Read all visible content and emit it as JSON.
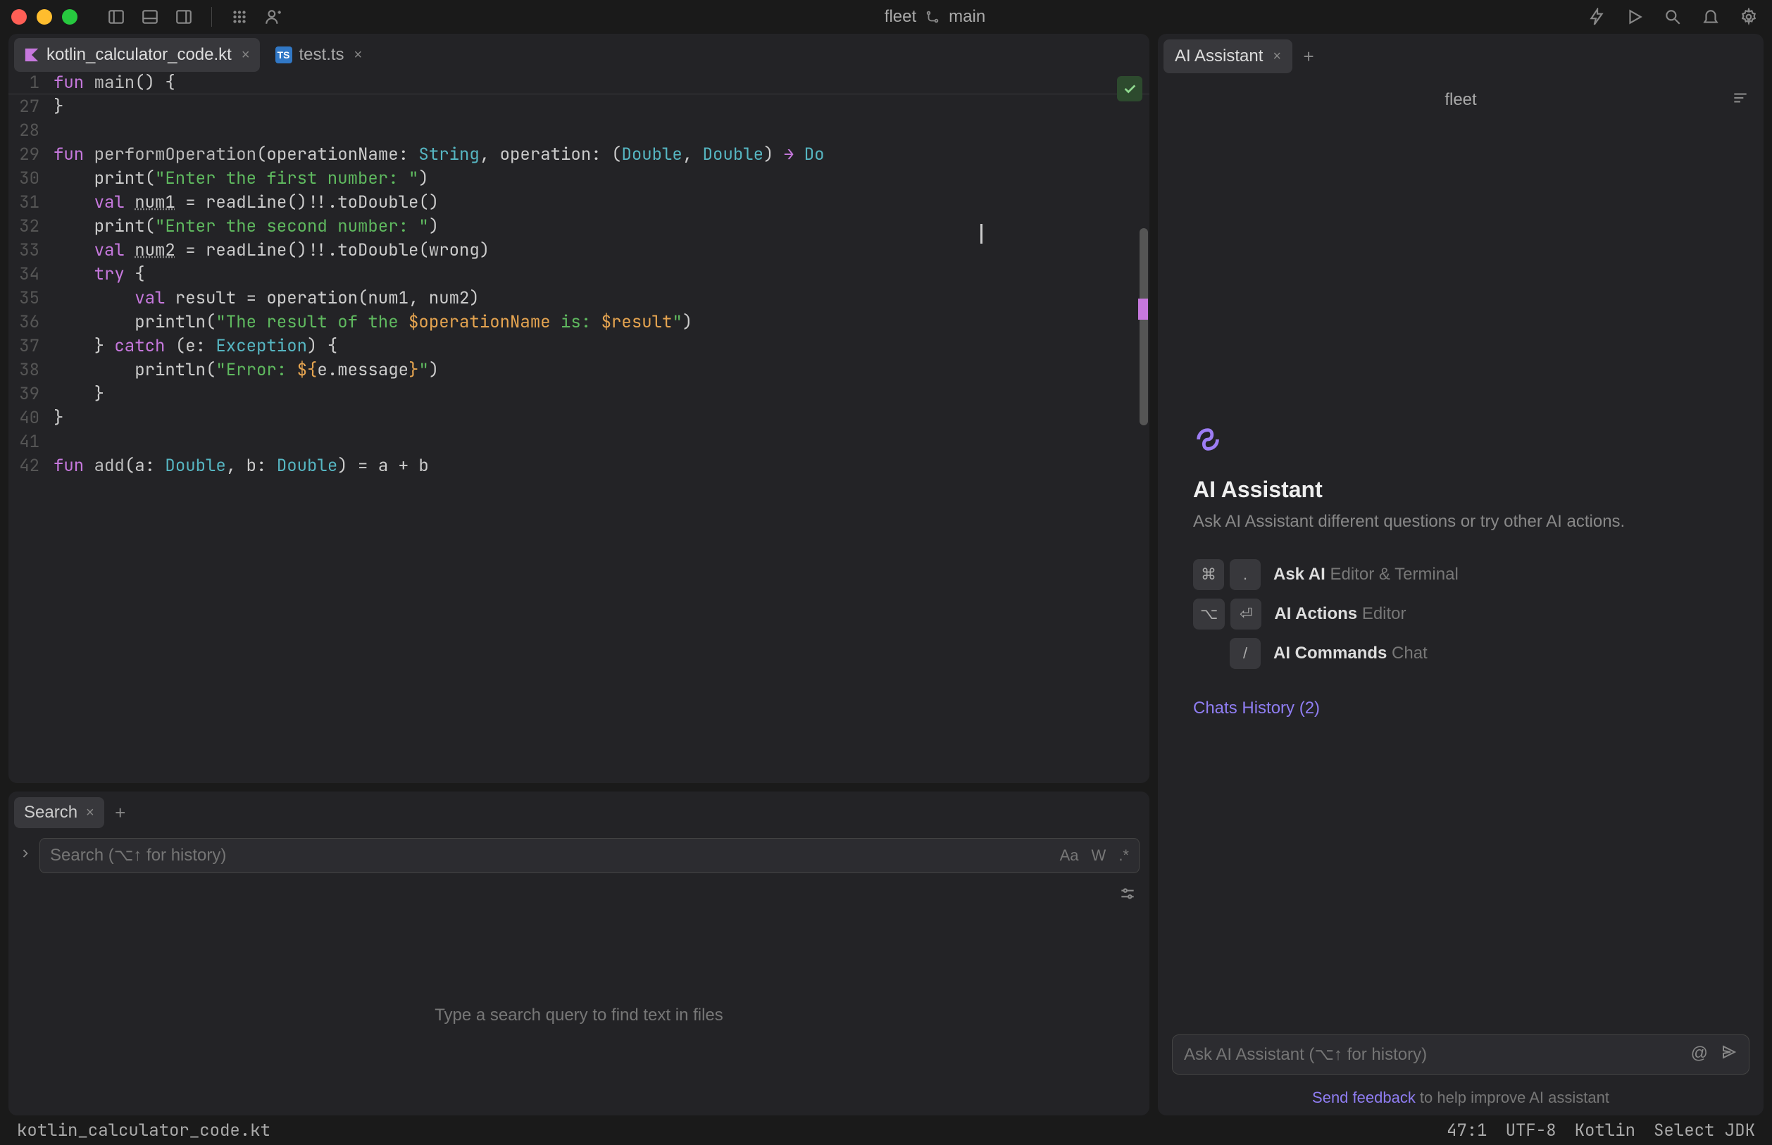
{
  "titlebar": {
    "project": "fleet",
    "branch": "main"
  },
  "tabs": [
    {
      "label": "kotlin_calculator_code.kt",
      "type": "kotlin",
      "active": true
    },
    {
      "label": "test.ts",
      "type": "ts",
      "active": false
    }
  ],
  "sticky": {
    "line": "1",
    "code_pre": "fun ",
    "code_fn": "main",
    "code_post": "() {"
  },
  "code": [
    {
      "n": "27",
      "html": "}"
    },
    {
      "n": "28",
      "html": ""
    },
    {
      "n": "29",
      "html": "<span class='kw'>fun</span> <span class='fn'>performOperation</span>(operationName: <span class='tp'>String</span>, operation: (<span class='tp'>Double</span>, <span class='tp'>Double</span>) <span class='kw'>→</span> <span class='tp'>Do</span>"
    },
    {
      "n": "30",
      "html": "    print(<span class='str'>\"Enter the first number: \"</span>)"
    },
    {
      "n": "31",
      "html": "    <span class='kw'>val</span> <span class='und'>num1</span> = readLine()!!.toDouble()"
    },
    {
      "n": "32",
      "html": "    print(<span class='str'>\"Enter the second number: \"</span>)"
    },
    {
      "n": "33",
      "html": "    <span class='kw'>val</span> <span class='und'>num2</span> = readLine()!!.toDouble(wrong)"
    },
    {
      "n": "34",
      "html": "    <span class='kw'>try</span> {"
    },
    {
      "n": "35",
      "html": "        <span class='kw'>val</span> result = operation(num1, num2)"
    },
    {
      "n": "36",
      "html": "        println(<span class='str'>\"The result of the </span><span class='strv'>$operationName</span><span class='str'> is: </span><span class='strv'>$result</span><span class='str'>\"</span>)"
    },
    {
      "n": "37",
      "html": "    } <span class='kw'>catch</span> (e: <span class='tp'>Exception</span>) {"
    },
    {
      "n": "38",
      "html": "        println(<span class='str'>\"Error: </span><span class='strv'>${</span>e.message<span class='strv'>}</span><span class='str'>\"</span>)"
    },
    {
      "n": "39",
      "html": "    }"
    },
    {
      "n": "40",
      "html": "}"
    },
    {
      "n": "41",
      "html": ""
    },
    {
      "n": "42",
      "html": "<span class='kw'>fun</span> <span class='fn'>add</span>(a: <span class='tp'>Double</span>, b: <span class='tp'>Double</span>) = a + b"
    }
  ],
  "search": {
    "tab": "Search",
    "placeholder": "Search (⌥↑ for history)",
    "opts": {
      "case": "Aa",
      "word": "W",
      "regex": ".*"
    },
    "empty": "Type a search query to find text in files"
  },
  "ai": {
    "tab": "AI Assistant",
    "project": "fleet",
    "title": "AI Assistant",
    "desc": "Ask AI Assistant different questions or try other AI actions.",
    "actions": [
      {
        "keys": [
          "⌘",
          "."
        ],
        "label": "Ask AI",
        "sub": "Editor & Terminal"
      },
      {
        "keys": [
          "⌥",
          "⏎"
        ],
        "label": "AI Actions",
        "sub": "Editor"
      },
      {
        "keys": [
          "/"
        ],
        "label": "AI Commands",
        "sub": "Chat"
      }
    ],
    "chats_history": "Chats History (2)",
    "input_placeholder": "Ask AI Assistant (⌥↑ for history)",
    "feedback_link": "Send feedback",
    "feedback_rest": " to help improve AI assistant"
  },
  "status": {
    "file": "kotlin_calculator_code.kt",
    "pos": "47:1",
    "encoding": "UTF-8",
    "lang": "Kotlin",
    "jdk": "Select JDK"
  }
}
